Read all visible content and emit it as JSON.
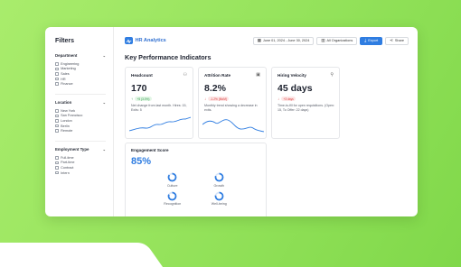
{
  "sidebar": {
    "title": "Filters",
    "groups": [
      {
        "label": "Department",
        "options": [
          "Engineering",
          "Marketing",
          "Sales",
          "HR",
          "Finance"
        ]
      },
      {
        "label": "Location",
        "options": [
          "New York",
          "San Francisco",
          "London",
          "Berlin",
          "Remote"
        ]
      },
      {
        "label": "Employment Type",
        "options": [
          "Full-time",
          "Part-time",
          "Contract",
          "Intern"
        ]
      }
    ]
  },
  "header": {
    "app_name": "HR Analytics",
    "date_range": "June 01, 2024 - June 30, 2024",
    "org_filter": "All Organizations",
    "export_label": "Export",
    "share_label": "Share"
  },
  "main": {
    "section_title": "Key Performance Indicators",
    "cards": [
      {
        "title": "Headcount",
        "value": "170",
        "change": "+5 (3.0%)",
        "direction": "up",
        "desc": "Net change from last month. Hires: 15, Exits: 5",
        "icon": "users-icon"
      },
      {
        "title": "Attrition Rate",
        "value": "8.2%",
        "change": "-1.2% (MoM)",
        "direction": "down",
        "desc": "Monthly trend showing a decrease in exits.",
        "icon": "calendar-icon"
      },
      {
        "title": "Hiring Velocity",
        "value": "45 days",
        "change": "+3 days",
        "direction": "down",
        "desc": "Time-to-fill for open requisitions. (Open: 15, To Offer: 22 days)",
        "icon": "search-icon"
      }
    ],
    "engagement": {
      "title": "Engagement Score",
      "value": "85%",
      "gauges": [
        {
          "label": "Culture",
          "value": 0.85
        },
        {
          "label": "Growth",
          "value": 0.8
        },
        {
          "label": "Recognition",
          "value": 0.82
        },
        {
          "label": "Well-being",
          "value": 0.78
        }
      ]
    }
  },
  "colors": {
    "accent": "#2f7de1",
    "positive": "#2e9a4a",
    "negative": "#d93a3a",
    "background": "#93e25a"
  }
}
